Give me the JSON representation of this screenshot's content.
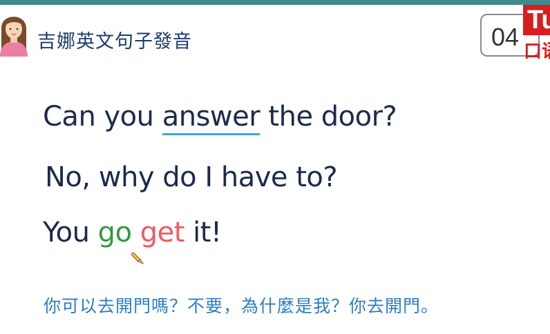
{
  "header": {
    "brand_title": "吉娜英文句子發音",
    "page_number": "04",
    "logo_top": "Tu",
    "logo_bottom": "口语"
  },
  "lesson": {
    "sentence1": {
      "before": "Can you ",
      "highlight": "answer",
      "after": " the door?"
    },
    "sentence2": "No, why do I have to?",
    "sentence3": {
      "before": "You ",
      "word1": "go",
      "space": " ",
      "word2": "get",
      "after": " it!"
    },
    "translation": "你可以去開門嗎？不要，為什麼是我？你去開門。"
  },
  "colors": {
    "accent_bar": "#3f8a8a",
    "text_dark": "#1b2a4e",
    "underline": "#3fa3db",
    "green_word": "#2f9a3e",
    "red_word": "#ef5a5f",
    "translation": "#2a7fc4",
    "logo_red": "#d81e1e"
  },
  "icons": {
    "avatar": "teacher-avatar-icon",
    "cursor": "pencil-cursor-icon"
  }
}
